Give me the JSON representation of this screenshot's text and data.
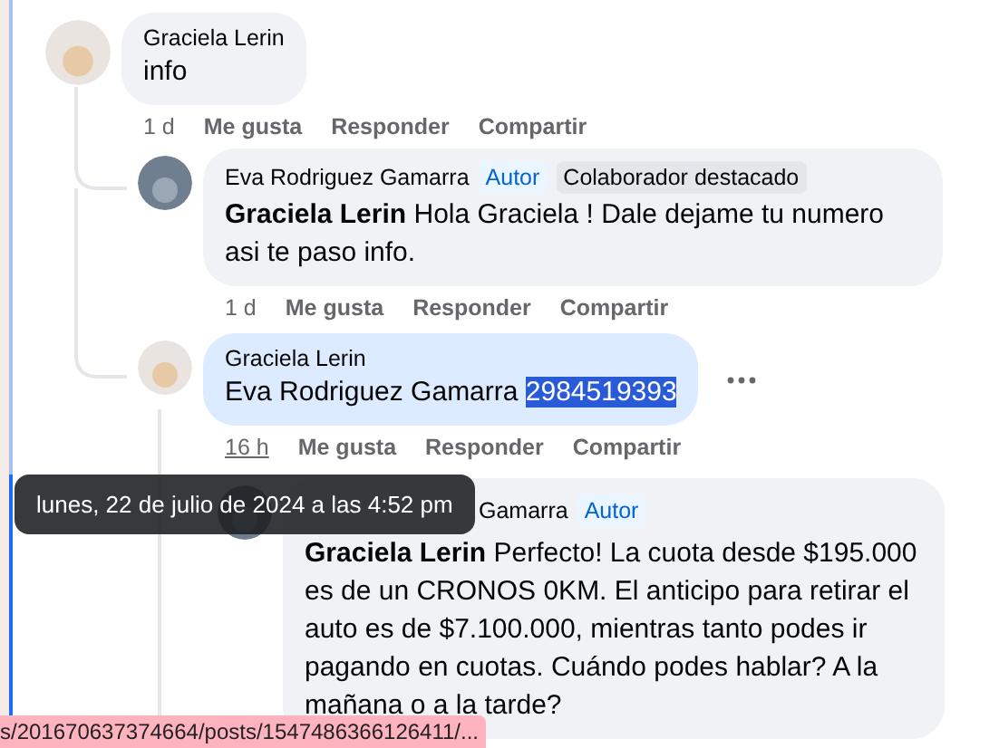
{
  "comment": {
    "author": "Graciela Lerin",
    "segments": [
      {
        "kind": "plain",
        "text": "info"
      }
    ],
    "time": "1 d",
    "time_hovered": false,
    "focused": false,
    "actions": [
      "Me gusta",
      "Responder",
      "Compartir"
    ],
    "replies": [
      {
        "author": "Eva Rodriguez Gamarra",
        "badges": [
          {
            "kind": "author",
            "label": "Autor"
          },
          {
            "kind": "top",
            "label": "Colaborador destacado"
          }
        ],
        "segments": [
          {
            "kind": "mention",
            "text": "Graciela Lerin"
          },
          {
            "kind": "plain",
            "text": " Hola Graciela ! Dale dejame tu numero asi te paso info."
          }
        ],
        "time": "1 d",
        "time_hovered": false,
        "focused": false,
        "actions": [
          "Me gusta",
          "Responder",
          "Compartir"
        ]
      },
      {
        "author": "Graciela Lerin",
        "segments": [
          {
            "kind": "plain",
            "text": "Eva Rodriguez Gamarra "
          },
          {
            "kind": "selected",
            "text": "2984519393"
          }
        ],
        "time": "16 h",
        "time_hovered": true,
        "focused": true,
        "more_menu": true,
        "actions": [
          "Me gusta",
          "Responder",
          "Compartir"
        ],
        "replies": [
          {
            "author": "Gamarra",
            "author_covered": true,
            "badges": [
              {
                "kind": "author",
                "label": "Autor"
              }
            ],
            "segments": [
              {
                "kind": "mention",
                "text": "Graciela Lerin"
              },
              {
                "kind": "plain",
                "text": " Perfecto! La cuota desde $195.000 es de un CRONOS 0KM. El anticipo para retirar el auto es de $7.100.000, mientras tanto podes ir pagando en cuotas. Cuándo podes hablar? A la mañana o a la tarde?"
              }
            ],
            "focused": false
          }
        ]
      }
    ]
  },
  "tooltip": "lunes, 22 de julio de 2024 a las 4:52 pm",
  "status_bar": "s/201670637374664/posts/1547486366126411/..."
}
